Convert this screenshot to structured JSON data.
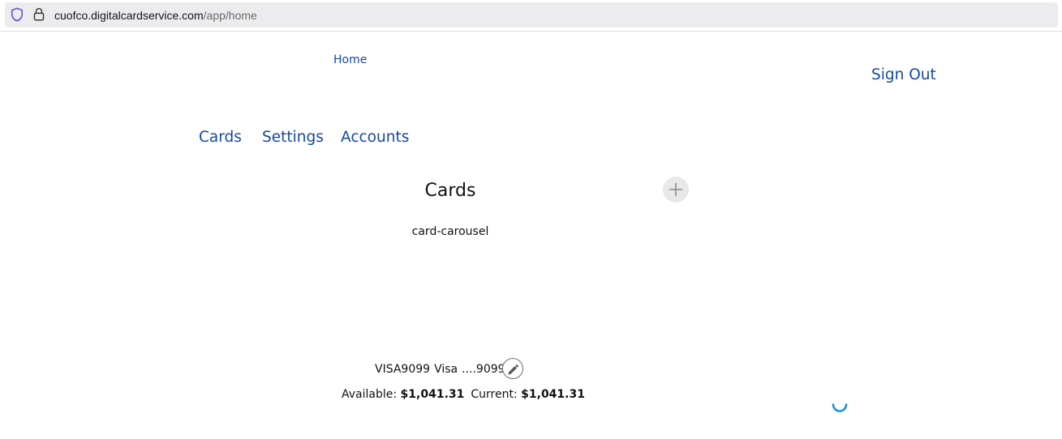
{
  "browser": {
    "url_domain": "cuofco.digitalcardservice.com",
    "url_path": "/app/home",
    "icons": [
      "shield-icon",
      "lock-icon"
    ]
  },
  "header": {
    "breadcrumb_home": "Home",
    "sign_out": "Sign Out"
  },
  "nav": {
    "items": [
      {
        "label": "Cards"
      },
      {
        "label": "Settings"
      },
      {
        "label": "Accounts"
      }
    ]
  },
  "main": {
    "title": "Cards",
    "add_icon": "plus-icon",
    "carousel_label": "card-carousel"
  },
  "card": {
    "code": "VISA9099",
    "brand": "Visa",
    "masked_number": "....9099",
    "edit_icon": "pencil-icon",
    "available_label": "Available:",
    "available_value": "$1,041.31",
    "current_label": "Current:",
    "current_value": "$1,041.31"
  },
  "status": {
    "spinner_icon": "loading-spinner-icon"
  },
  "colors": {
    "link": "#1549a2",
    "spinner": "#1a8fe0",
    "shield": "#5b5bd6"
  }
}
